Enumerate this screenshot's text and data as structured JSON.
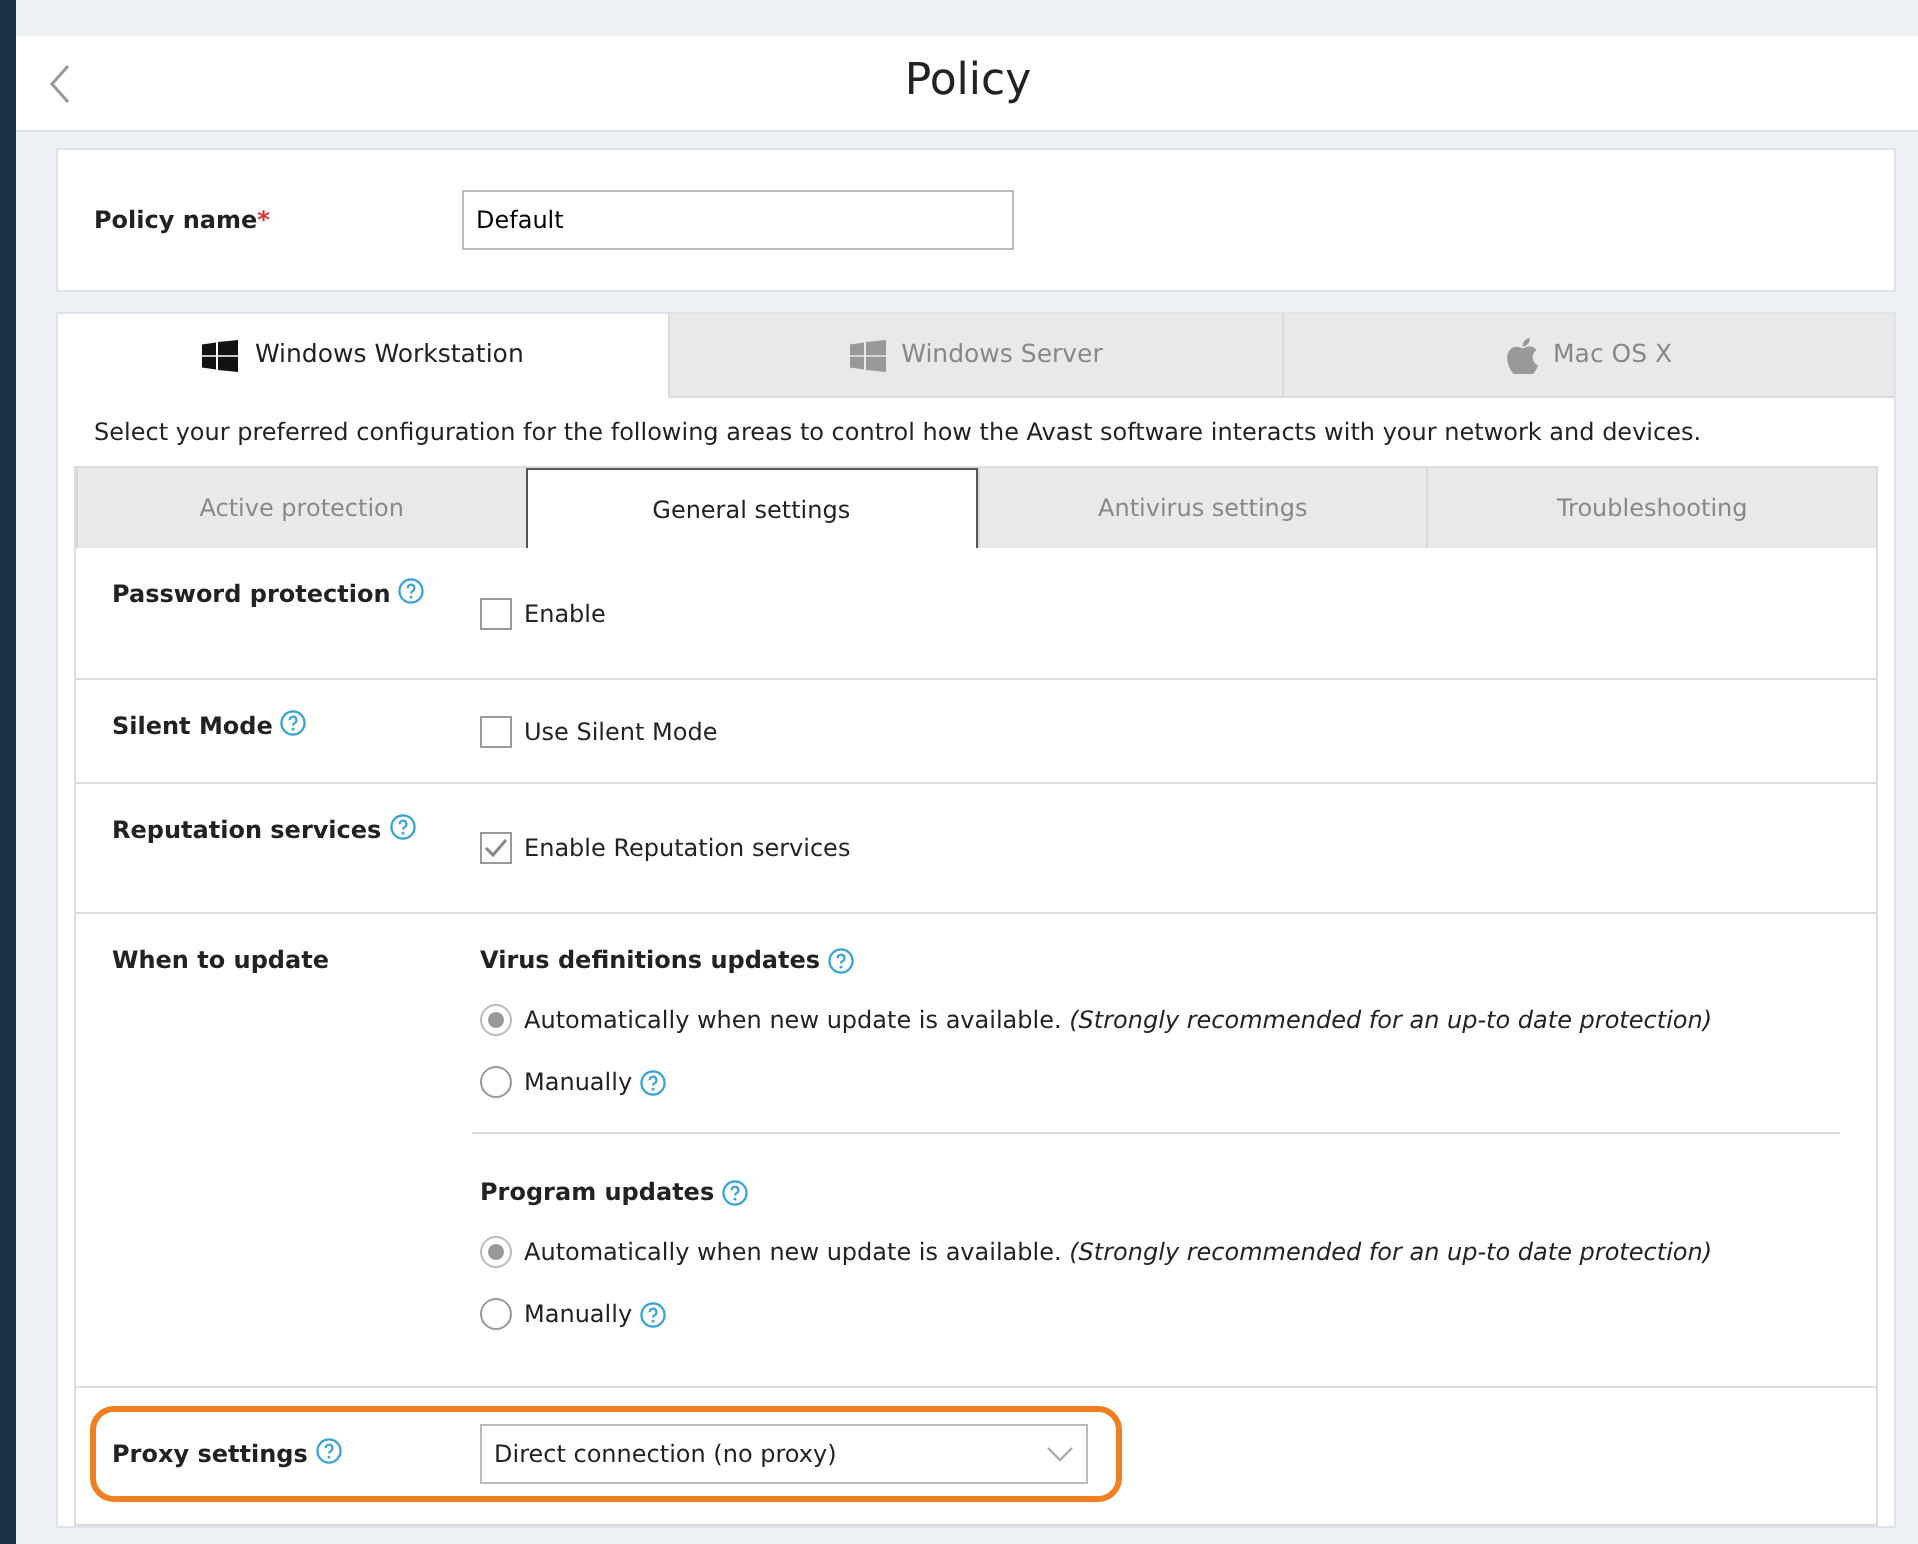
{
  "header": {
    "title": "Policy"
  },
  "policy_name": {
    "label": "Policy name",
    "required_mark": "*",
    "value": "Default"
  },
  "platform_tabs": [
    {
      "label": "Windows Workstation",
      "kind": "windows",
      "selected": true
    },
    {
      "label": "Windows Server",
      "kind": "windows",
      "selected": false
    },
    {
      "label": "Mac OS X",
      "kind": "apple",
      "selected": false
    }
  ],
  "description": "Select your preferred configuration for the following areas to control how the Avast software interacts with your network and devices.",
  "section_tabs": [
    {
      "label": "Active protection",
      "selected": false
    },
    {
      "label": "General settings",
      "selected": true
    },
    {
      "label": "Antivirus settings",
      "selected": false
    },
    {
      "label": "Troubleshooting",
      "selected": false
    }
  ],
  "settings": [
    {
      "kind": "checkbox",
      "label": "Password protection",
      "help": true,
      "option": "Enable",
      "checked": false
    },
    {
      "kind": "checkbox",
      "label": "Silent Mode",
      "help": true,
      "option": "Use Silent Mode",
      "checked": false
    },
    {
      "kind": "checkbox",
      "label": "Reputation services",
      "help": true,
      "option": "Enable Reputation services",
      "checked": true
    },
    {
      "kind": "updates",
      "label": "When to update",
      "help": false,
      "groups": [
        {
          "title": "Virus definitions updates",
          "options": [
            {
              "text": "Automatically when new update is available. *(Strongly recommended for an up-to date protection)*",
              "selected": true,
              "help": false
            },
            {
              "text": "Manually",
              "selected": false,
              "help": true
            }
          ]
        },
        {
          "title": "Program updates",
          "options": [
            {
              "text": "Automatically when new update is available. *(Strongly recommended for an up-to date protection)*",
              "selected": true,
              "help": false
            },
            {
              "text": "Manually",
              "selected": false,
              "help": true
            }
          ]
        }
      ]
    },
    {
      "kind": "select",
      "label": "Proxy settings",
      "help": true,
      "value": "Direct connection (no proxy)",
      "highlighted": true
    }
  ]
}
